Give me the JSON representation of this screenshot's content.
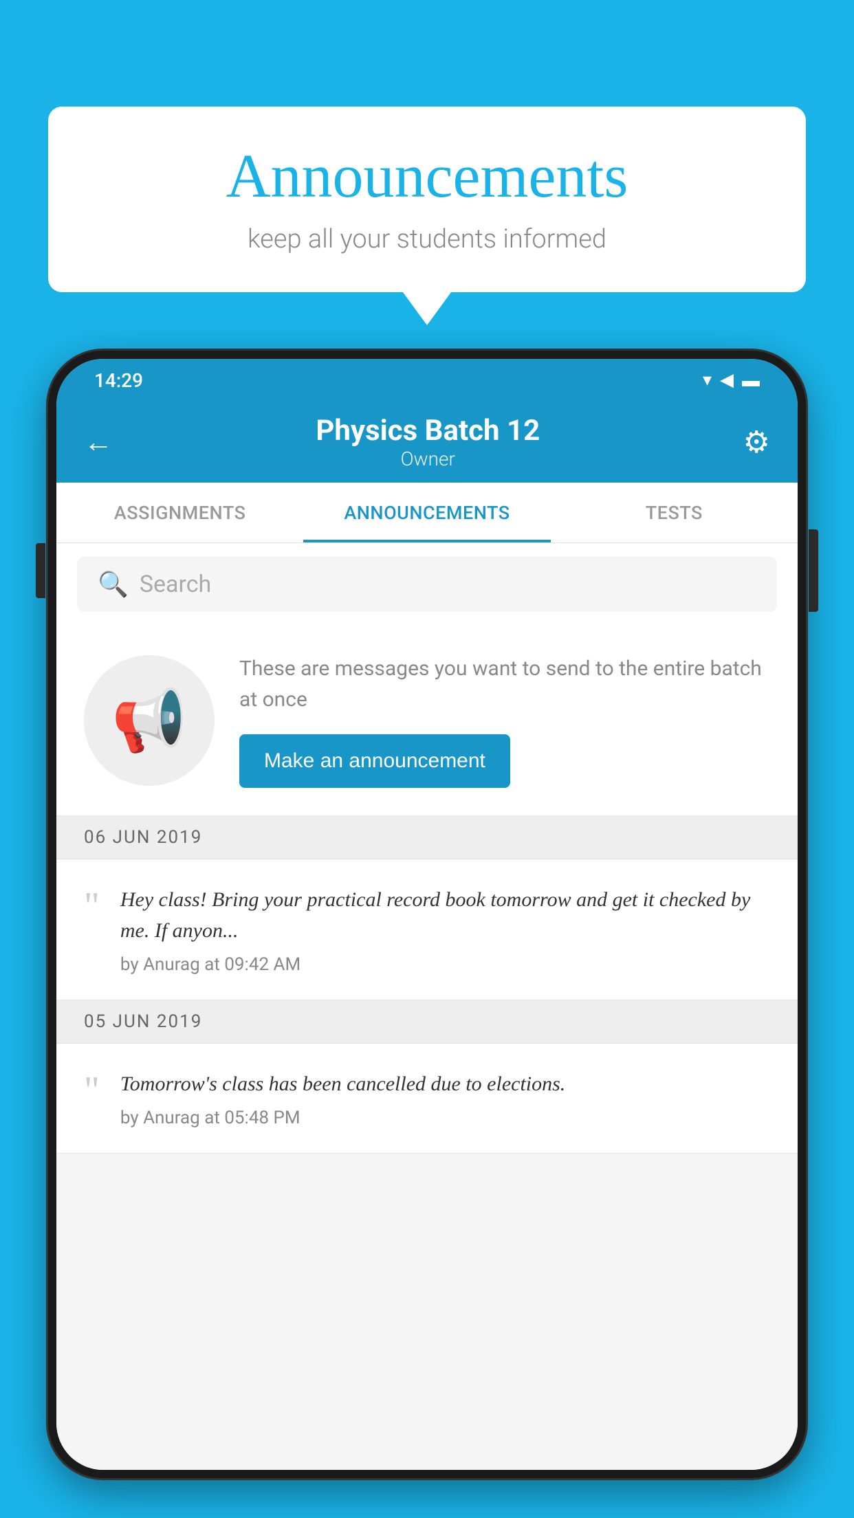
{
  "background_color": "#1ab3e8",
  "speech_bubble": {
    "title": "Announcements",
    "subtitle": "keep all your students informed"
  },
  "phone": {
    "status_bar": {
      "time": "14:29",
      "icons": [
        "wifi",
        "signal",
        "battery"
      ]
    },
    "header": {
      "back_label": "←",
      "title": "Physics Batch 12",
      "subtitle": "Owner",
      "settings_label": "⚙"
    },
    "tabs": [
      {
        "label": "ASSIGNMENTS",
        "active": false
      },
      {
        "label": "ANNOUNCEMENTS",
        "active": true
      },
      {
        "label": "TESTS",
        "active": false
      },
      {
        "label": "...",
        "active": false
      }
    ],
    "search": {
      "placeholder": "Search"
    },
    "announcement_prompt": {
      "description": "These are messages you want to send to the entire batch at once",
      "button_label": "Make an announcement"
    },
    "announcements": [
      {
        "date": "06  JUN  2019",
        "text": "Hey class! Bring your practical record book tomorrow and get it checked by me. If anyon...",
        "meta": "by Anurag at 09:42 AM"
      },
      {
        "date": "05  JUN  2019",
        "text": "Tomorrow's class has been cancelled due to elections.",
        "meta": "by Anurag at 05:48 PM"
      }
    ]
  }
}
